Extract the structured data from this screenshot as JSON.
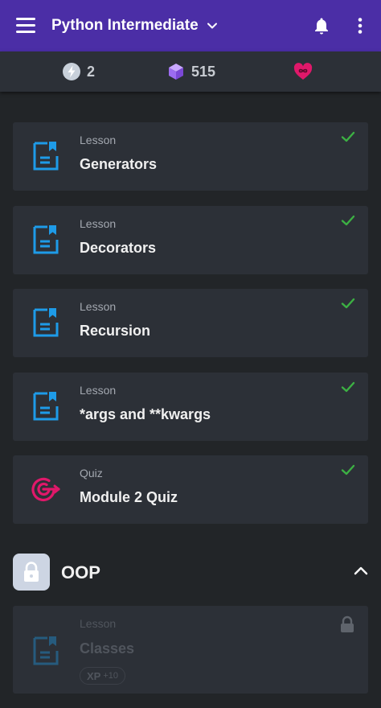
{
  "header": {
    "title": "Python Intermediate"
  },
  "stats": {
    "streak": "2",
    "gems": "515"
  },
  "lessons": [
    {
      "type": "Lesson",
      "name": "Generators"
    },
    {
      "type": "Lesson",
      "name": "Decorators"
    },
    {
      "type": "Lesson",
      "name": "Recursion"
    },
    {
      "type": "Lesson",
      "name": "*args and **kwargs"
    },
    {
      "type": "Quiz",
      "name": "Module 2 Quiz"
    }
  ],
  "section": {
    "title": "OOP"
  },
  "locked_lesson": {
    "type": "Lesson",
    "name": "Classes",
    "xp_label": "XP",
    "xp_value": "+10"
  },
  "colors": {
    "appbar": "#4b2ea6",
    "background": "#222528",
    "card": "#2c3037",
    "lesson_icon": "#1e9be8",
    "quiz_icon": "#e0186a",
    "check": "#3cb043",
    "heart": "#e0186a"
  },
  "icons": {
    "menu": "hamburger-icon",
    "title_dropdown": "chevron-down-icon",
    "notifications": "bell-icon",
    "more": "more-vert-icon",
    "streak": "lightning-icon",
    "gems": "gem-cube-icon",
    "hearts": "infinity-heart-icon",
    "lesson": "document-bookmark-icon",
    "quiz": "target-icon",
    "completed": "check-icon",
    "locked": "lock-icon",
    "collapse": "chevron-up-icon"
  }
}
